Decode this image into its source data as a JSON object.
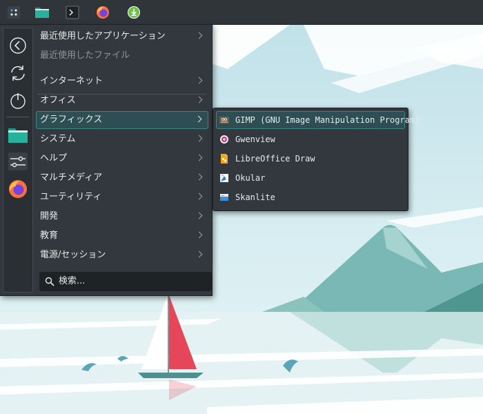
{
  "panel": {
    "launchers": [
      {
        "name": "application-launcher",
        "icon": "application-menu-icon"
      },
      {
        "name": "file-manager",
        "icon": "folder-icon"
      },
      {
        "name": "terminal",
        "icon": "terminal-icon"
      },
      {
        "name": "firefox",
        "icon": "firefox-icon"
      },
      {
        "name": "downloader",
        "icon": "download-icon"
      }
    ]
  },
  "sidebar": {
    "items": [
      {
        "icon": "back-icon"
      },
      {
        "icon": "refresh-icon"
      },
      {
        "icon": "power-icon"
      },
      {
        "icon": "folder-icon"
      },
      {
        "icon": "settings-icon"
      },
      {
        "icon": "firefox-icon"
      }
    ]
  },
  "menu": {
    "items": [
      {
        "label": "最近使用したアプリケーション",
        "submenu": true
      },
      {
        "label": "最近使用したファイル",
        "disabled": true
      },
      {
        "label": "インターネット",
        "submenu": true
      },
      {
        "label": "オフィス",
        "submenu": true
      },
      {
        "label": "グラフィックス",
        "submenu": true,
        "active": true
      },
      {
        "label": "システム",
        "submenu": true
      },
      {
        "label": "ヘルプ",
        "submenu": true
      },
      {
        "label": "マルチメディア",
        "submenu": true
      },
      {
        "label": "ユーティリティ",
        "submenu": true
      },
      {
        "label": "開発",
        "submenu": true
      },
      {
        "label": "教育",
        "submenu": true
      },
      {
        "label": "電源/セッション",
        "submenu": true
      }
    ],
    "search": {
      "placeholder": "検索..."
    }
  },
  "submenu": {
    "items": [
      {
        "label": "GIMP (GNU Image Manipulation Program)",
        "icon": "gimp-icon",
        "active": true
      },
      {
        "label": "Gwenview",
        "icon": "gwenview-icon"
      },
      {
        "label": "LibreOffice Draw",
        "icon": "libreoffice-draw-icon"
      },
      {
        "label": "Okular",
        "icon": "okular-icon"
      },
      {
        "label": "Skanlite",
        "icon": "skanlite-icon"
      }
    ]
  },
  "colors": {
    "panel": "#30353a",
    "menu_bg": "#32383d",
    "highlight_bg": "#2d4e52",
    "highlight_border": "#3f8585",
    "sky": "#d2e8ee",
    "mountain": "#79b8b4",
    "sail": "#e5465a"
  }
}
